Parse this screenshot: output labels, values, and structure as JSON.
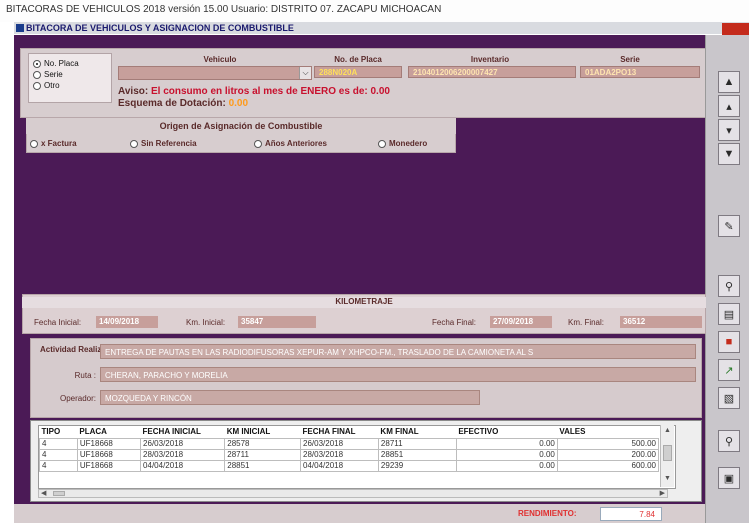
{
  "window": {
    "title": "BITACORAS  DE VEHICULOS 2018  versión  15.00 Usuario: DISTRITO 07. ZACAPU MICHOACAN",
    "subtitle": "BITACORA DE VEHICULOS Y ASIGNACION DE COMBUSTIBLE"
  },
  "search": {
    "options": [
      "No. Placa",
      "Serie",
      "Otro"
    ],
    "selected": "No. Placa"
  },
  "vehicle": {
    "vehiculo_label": "Vehiculo",
    "placa_label": "No. de Placa",
    "inventario_label": "Inventario",
    "serie_label": "Serie",
    "vehiculo_value": "",
    "placa_value": "288N020A",
    "inventario_value": "2104012006200007427",
    "serie_value": "01ADA2PO13"
  },
  "aviso": {
    "label": "Aviso:",
    "text": "El consumo en litros al mes de ENERO es de: 0.00"
  },
  "esquema": {
    "label": "Esquema de Dotación:",
    "value": "0.00"
  },
  "origen": {
    "title": "Origen de Asignación de Combustible",
    "options": [
      "x Factura",
      "Sin Referencia",
      "Años Anteriores",
      "Monedero"
    ]
  },
  "kilometraje": {
    "title": "KILOMETRAJE",
    "fecha_inicial_label": "Fecha Inicial:",
    "fecha_inicial": "14/09/2018",
    "km_inicial_label": "Km. Inicial:",
    "km_inicial": "35847",
    "fecha_final_label": "Fecha Final:",
    "fecha_final": "27/09/2018",
    "km_final_label": "Km. Final:",
    "km_final": "36512"
  },
  "actividad": {
    "label": "Actividad Realizada",
    "value": "ENTREGA DE PAUTAS EN LAS RADIODIFUSORAS XEPUR-AM Y XHPCO-FM., TRASLADO DE LA CAMIONETA AL S",
    "ruta_label": "Ruta :",
    "ruta_value": "CHERAN, PARACHO Y MORELIA",
    "operador_label": "Operador:",
    "operador_value": "MOZQUEDA Y RINCÓN"
  },
  "table": {
    "columns": [
      "TIPO",
      "PLACA",
      "FECHA INICIAL",
      "KM INICIAL",
      "FECHA FINAL",
      "KM FINAL",
      "EFECTIVO",
      "VALES"
    ],
    "rows": [
      [
        "4",
        "UF18668",
        "26/03/2018",
        "28578",
        "26/03/2018",
        "28711",
        "0.00",
        "500.00"
      ],
      [
        "4",
        "UF18668",
        "28/03/2018",
        "28711",
        "28/03/2018",
        "28851",
        "0.00",
        "200.00"
      ],
      [
        "4",
        "UF18668",
        "04/04/2018",
        "28851",
        "04/04/2018",
        "29239",
        "0.00",
        "600.00"
      ]
    ]
  },
  "rendimiento": {
    "label": "RENDIMIENTO:",
    "value": "7.84"
  },
  "colors": {
    "background_purple": "#4b1a56",
    "panel": "#d7cdcf",
    "field": "#c79f9b",
    "warning_red": "#c8102e",
    "accent_orange": "#ff9a1a"
  }
}
